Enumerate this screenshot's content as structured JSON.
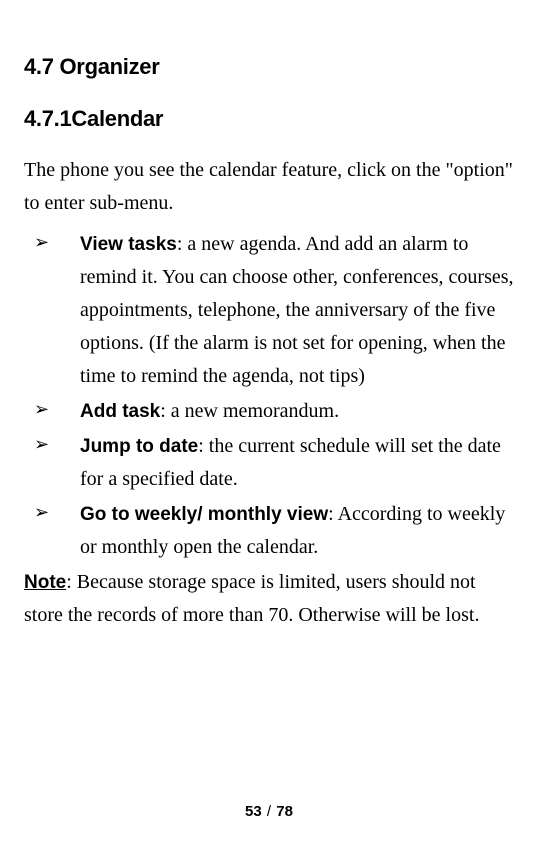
{
  "headings": {
    "h1": "4.7 Organizer",
    "h2": "4.7.1Calendar"
  },
  "intro": "The phone you see the calendar feature, click on the \"option\" to enter sub-menu.",
  "bullets": [
    {
      "label": "View tasks",
      "text": ": a new agenda. And add an alarm to remind it. You can choose other, conferences, courses, appointments, telephone, the anniversary of the five options. (If the alarm is not set for opening, when the time to remind the agenda, not tips)"
    },
    {
      "label": "Add task",
      "text": ": a new memorandum."
    },
    {
      "label": "Jump to date",
      "text": ": the current schedule will set the date for a specified date."
    },
    {
      "label": "Go to weekly/ monthly  view",
      "text": ": According to weekly or monthly open the calendar."
    }
  ],
  "note": {
    "label": "Note",
    "text": ": Because storage space is limited, users should not store the records of more than 70. Otherwise will be lost."
  },
  "footer": {
    "current": "53",
    "sep": "/",
    "total": "78"
  },
  "glyphs": {
    "bullet": "➢"
  }
}
